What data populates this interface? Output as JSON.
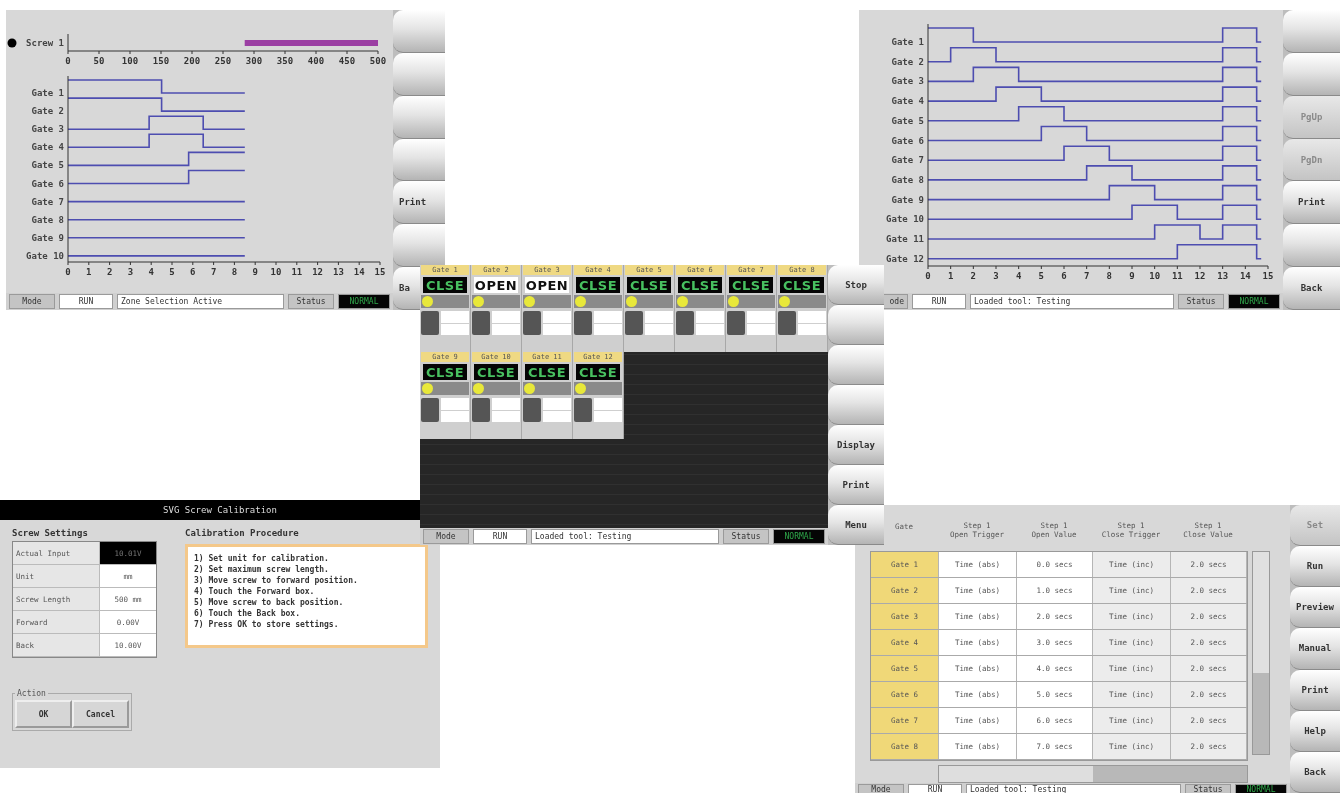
{
  "zone_timing_screen": {
    "screw_chart": {
      "chart_data": {
        "type": "bar",
        "orientation": "horizontal",
        "xlim": [
          0,
          500
        ],
        "xticks": [
          0,
          50,
          100,
          150,
          200,
          250,
          300,
          350,
          400,
          450,
          500
        ],
        "series": [
          {
            "name": "Screw 1",
            "color": "#9b3fa3",
            "values": [
              500
            ],
            "base": [
              285
            ]
          }
        ]
      }
    },
    "gate_chart": {
      "gate_labels": [
        "Gate 1",
        "Gate 2",
        "Gate 3",
        "Gate 4",
        "Gate 5",
        "Gate 6",
        "Gate 7",
        "Gate 8",
        "Gate 9",
        "Gate 10"
      ],
      "x_ticks": [
        "0",
        "1",
        "2",
        "3",
        "4",
        "5",
        "6",
        "7",
        "8",
        "9",
        "10",
        "11",
        "12",
        "13",
        "14",
        "15"
      ]
    },
    "side_buttons": [
      {
        "kind": "blank"
      },
      {
        "kind": "blank"
      },
      {
        "kind": "blank"
      },
      {
        "kind": "blank"
      },
      {
        "kind": "text",
        "label": "Print"
      },
      {
        "kind": "blank"
      },
      {
        "kind": "text",
        "label": "Ba"
      }
    ],
    "status_bar": {
      "mode_label": "Mode",
      "mode": "RUN",
      "message": "Zone Selection Active",
      "status_label": "Status",
      "status": "NORMAL"
    }
  },
  "sequence_timing_screen": {
    "gate_chart": {
      "gate_labels": [
        "Gate 1",
        "Gate 2",
        "Gate 3",
        "Gate 4",
        "Gate 5",
        "Gate 6",
        "Gate 7",
        "Gate 8",
        "Gate 9",
        "Gate 10",
        "Gate 11",
        "Gate 12"
      ],
      "x_ticks": [
        "0",
        "1",
        "2",
        "3",
        "4",
        "5",
        "6",
        "7",
        "8",
        "9",
        "10",
        "11",
        "12",
        "13",
        "14",
        "15"
      ]
    },
    "side_buttons": [
      {
        "kind": "blank",
        "disabled": false
      },
      {
        "kind": "blank",
        "disabled": false
      },
      {
        "kind": "text",
        "label": "PgUp",
        "disabled": true
      },
      {
        "kind": "text",
        "label": "PgDn",
        "disabled": true
      },
      {
        "kind": "text",
        "label": "Print",
        "disabled": false
      },
      {
        "kind": "blank",
        "disabled": false
      },
      {
        "kind": "text",
        "label": "Back",
        "disabled": false
      }
    ],
    "status_bar": {
      "mode_label": "ode",
      "mode": "RUN",
      "message": "Loaded tool: Testing",
      "status_label": "Status",
      "status": "NORMAL"
    }
  },
  "gate_overview_screen": {
    "gates": [
      {
        "label": "Gate 1",
        "state": "CLSE",
        "open": false
      },
      {
        "label": "Gate 2",
        "state": "OPEN",
        "open": true
      },
      {
        "label": "Gate 3",
        "state": "OPEN",
        "open": true
      },
      {
        "label": "Gate 4",
        "state": "CLSE",
        "open": false
      },
      {
        "label": "Gate 5",
        "state": "CLSE",
        "open": false
      },
      {
        "label": "Gate 6",
        "state": "CLSE",
        "open": false
      },
      {
        "label": "Gate 7",
        "state": "CLSE",
        "open": false
      },
      {
        "label": "Gate 8",
        "state": "CLSE",
        "open": false
      },
      {
        "label": "Gate 9",
        "state": "CLSE",
        "open": false
      },
      {
        "label": "Gate 10",
        "state": "CLSE",
        "open": false
      },
      {
        "label": "Gate 11",
        "state": "CLSE",
        "open": false
      },
      {
        "label": "Gate 12",
        "state": "CLSE",
        "open": false
      }
    ],
    "side_buttons": [
      {
        "kind": "text",
        "label": "Stop"
      },
      {
        "kind": "blank"
      },
      {
        "kind": "blank"
      },
      {
        "kind": "blank"
      },
      {
        "kind": "text",
        "label": "Display"
      },
      {
        "kind": "text",
        "label": "Print"
      },
      {
        "kind": "text",
        "label": "Menu"
      }
    ],
    "status_bar": {
      "mode_label": "Mode",
      "mode": "RUN",
      "message": "Loaded tool: Testing",
      "status_label": "Status",
      "status": "NORMAL"
    }
  },
  "calibration_dialog": {
    "title": "SVG Screw Calibration",
    "settings_title": "Screw Settings",
    "settings": [
      {
        "label": "Actual Input",
        "value": "10.01V",
        "highlighted": true
      },
      {
        "label": "Unit",
        "value": "mm",
        "highlighted": false
      },
      {
        "label": "Screw Length",
        "value": "500 mm",
        "highlighted": false
      },
      {
        "label": "Forward",
        "value": "0.00V",
        "highlighted": false
      },
      {
        "label": "Back",
        "value": "10.00V",
        "highlighted": false
      }
    ],
    "procedure_title": "Calibration Procedure",
    "procedure": [
      "1) Set unit for calibration.",
      "2) Set maximum screw length.",
      "3) Move screw to forward position.",
      "4) Touch the Forward box.",
      "5) Move screw to back position.",
      "6) Touch the Back box.",
      "7) Press OK to store settings."
    ],
    "action_group": "Action",
    "buttons": [
      "OK",
      "Cancel"
    ]
  },
  "gate_table_screen": {
    "columns": [
      {
        "title": "Gate"
      },
      {
        "step": "Step 1",
        "title": "Open Trigger"
      },
      {
        "step": "Step 1",
        "title": "Open Value"
      },
      {
        "step": "Step 1",
        "title": "Close Trigger"
      },
      {
        "step": "Step 1",
        "title": "Close Value"
      }
    ],
    "rows": [
      {
        "gate": "Gate 1",
        "open_trigger": "Time (abs)",
        "open_value": "0.0 secs",
        "close_trigger": "Time (inc)",
        "close_value": "2.0 secs"
      },
      {
        "gate": "Gate 2",
        "open_trigger": "Time (abs)",
        "open_value": "1.0 secs",
        "close_trigger": "Time (inc)",
        "close_value": "2.0 secs"
      },
      {
        "gate": "Gate 3",
        "open_trigger": "Time (abs)",
        "open_value": "2.0 secs",
        "close_trigger": "Time (inc)",
        "close_value": "2.0 secs"
      },
      {
        "gate": "Gate 4",
        "open_trigger": "Time (abs)",
        "open_value": "3.0 secs",
        "close_trigger": "Time (inc)",
        "close_value": "2.0 secs"
      },
      {
        "gate": "Gate 5",
        "open_trigger": "Time (abs)",
        "open_value": "4.0 secs",
        "close_trigger": "Time (inc)",
        "close_value": "2.0 secs"
      },
      {
        "gate": "Gate 6",
        "open_trigger": "Time (abs)",
        "open_value": "5.0 secs",
        "close_trigger": "Time (inc)",
        "close_value": "2.0 secs"
      },
      {
        "gate": "Gate 7",
        "open_trigger": "Time (abs)",
        "open_value": "6.0 secs",
        "close_trigger": "Time (inc)",
        "close_value": "2.0 secs"
      },
      {
        "gate": "Gate 8",
        "open_trigger": "Time (abs)",
        "open_value": "7.0 secs",
        "close_trigger": "Time (inc)",
        "close_value": "2.0 secs"
      }
    ],
    "side_buttons": [
      {
        "kind": "text",
        "label": "Set",
        "disabled": true
      },
      {
        "kind": "text",
        "label": "Run",
        "disabled": false
      },
      {
        "kind": "text",
        "label": "Preview",
        "disabled": false
      },
      {
        "kind": "text",
        "label": "Manual",
        "disabled": false
      },
      {
        "kind": "text",
        "label": "Print",
        "disabled": false
      },
      {
        "kind": "text",
        "label": "Help",
        "disabled": false
      },
      {
        "kind": "text",
        "label": "Back",
        "disabled": false
      }
    ],
    "status_bar": {
      "mode_label": "Mode",
      "mode": "RUN",
      "message": "Loaded tool: Testing",
      "status_label": "Status",
      "status": "NORMAL"
    }
  }
}
